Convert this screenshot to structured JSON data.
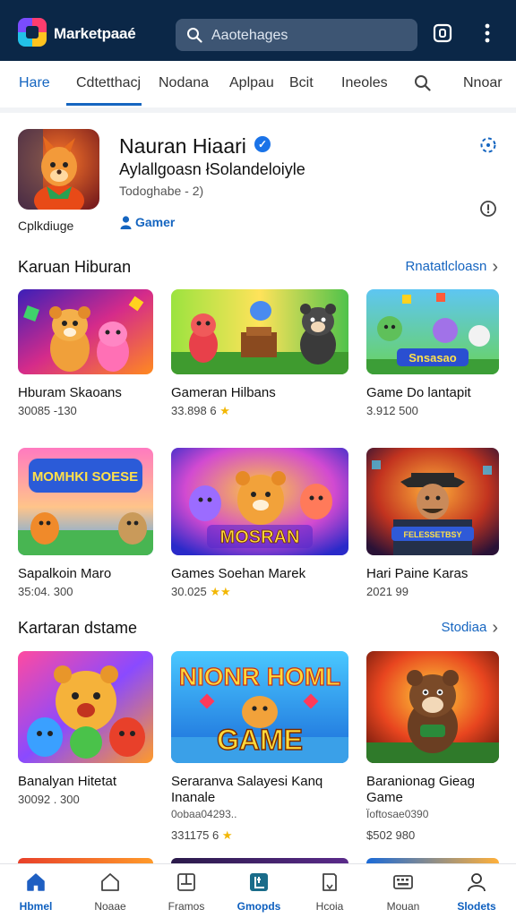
{
  "app": {
    "brand": "Marketpaaé"
  },
  "search": {
    "placeholder": "Aaotehages"
  },
  "icons": {
    "logo": "app-logo",
    "search": "search-icon",
    "qr": "scan-icon",
    "more": "more-vertical-icon"
  },
  "tabs": [
    {
      "label": "Hare",
      "active": false
    },
    {
      "label": "Cdtetthacj",
      "active": true
    },
    {
      "label": "Nodana",
      "active": false
    },
    {
      "label": "Aplpau",
      "active": false
    },
    {
      "label": "Bcit",
      "active": false
    },
    {
      "label": "Ineoles",
      "active": false
    },
    {
      "label": "search-icon",
      "active": false
    },
    {
      "label": "Nnoar",
      "active": false
    }
  ],
  "featured": {
    "title": "Nauran Hiaari",
    "subtitle": "Aylallgoasn łSolandeloiyle",
    "meta": "Todoghabe - 2)",
    "caption": "Cplkdiuge",
    "category": "Gamer"
  },
  "sections": [
    {
      "title": "Karuan Hiburan",
      "link": "Rnatatlcloasn",
      "cards": [
        {
          "title": "Hburam Skaoans",
          "meta": "30085 -130",
          "stars": ""
        },
        {
          "title": "Gameran Hilbans",
          "meta": "33.898 6",
          "stars": "★"
        },
        {
          "title": "Game Do lantapit",
          "meta": "3.912 500",
          "stars": ""
        }
      ]
    },
    {
      "title": "",
      "link": "",
      "cards": [
        {
          "title": "Sapalkoin Maro",
          "meta": "35:04. 300",
          "stars": ""
        },
        {
          "title": "Games Soehan Marek",
          "meta": "30.025",
          "stars": "★★"
        },
        {
          "title": "Hari Paine Karas",
          "meta": "2021 99",
          "stars": ""
        }
      ]
    },
    {
      "title": "Kartaran dstame",
      "link": "Stodiaa",
      "cards": [
        {
          "title": "Banalyan Hitetat",
          "extra": "",
          "meta": "30092 . 300",
          "stars": ""
        },
        {
          "title": "Seraranva Salayesi Kanq Inanale",
          "extra": "0obaa04293..",
          "meta": "331175 6",
          "stars": "★"
        },
        {
          "title": "Baranionag Gieag Game",
          "extra": "Ïoftosae0390",
          "meta": "$502 980",
          "stars": ""
        }
      ]
    }
  ],
  "thumbnail_texts": {
    "s1c3": "Snsasao",
    "s2c1": "MOMHKI SOESE",
    "s2c2": "MOSRAN",
    "s2c3": "FELESSETBSY",
    "s3c2a": "NIONR HOML",
    "s3c2b": "GAME"
  },
  "bottom_nav": [
    {
      "label": "Hbmel",
      "icon": "home-icon",
      "active": true
    },
    {
      "label": "Noaae",
      "icon": "home-outline-icon",
      "active": false
    },
    {
      "label": "Framos",
      "icon": "frame-icon",
      "active": false
    },
    {
      "label": "Gmopds",
      "icon": "games-icon",
      "active": true
    },
    {
      "label": "Hcoia",
      "icon": "book-icon",
      "active": false
    },
    {
      "label": "Mouan",
      "icon": "keyboard-icon",
      "active": false
    },
    {
      "label": "Slodets",
      "icon": "person-icon",
      "active": true
    }
  ]
}
